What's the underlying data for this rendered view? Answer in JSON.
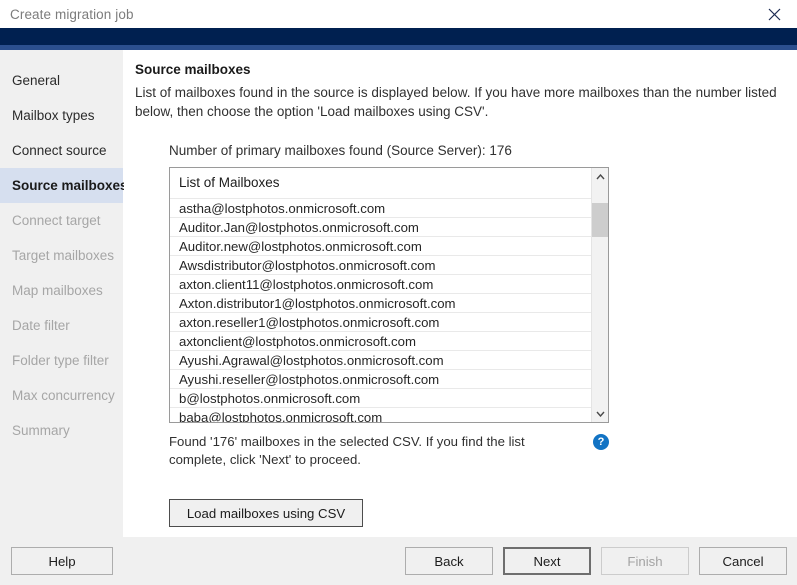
{
  "window": {
    "title": "Create migration job",
    "close_icon": "close-icon"
  },
  "sidebar": {
    "items": [
      {
        "label": "General",
        "state": "enabled"
      },
      {
        "label": "Mailbox types",
        "state": "enabled"
      },
      {
        "label": "Connect source",
        "state": "enabled"
      },
      {
        "label": "Source mailboxes",
        "state": "active"
      },
      {
        "label": "Connect target",
        "state": "disabled"
      },
      {
        "label": "Target mailboxes",
        "state": "disabled"
      },
      {
        "label": "Map mailboxes",
        "state": "disabled"
      },
      {
        "label": "Date filter",
        "state": "disabled"
      },
      {
        "label": "Folder type filter",
        "state": "disabled"
      },
      {
        "label": "Max concurrency",
        "state": "disabled"
      },
      {
        "label": "Summary",
        "state": "disabled"
      }
    ]
  },
  "main": {
    "title": "Source mailboxes",
    "description": "List of mailboxes found in the source is displayed below. If you have more mailboxes than the number listed below, then choose the option 'Load mailboxes using CSV'.",
    "count_line": "Number of primary mailboxes found (Source Server): 176",
    "list": {
      "header": "List of Mailboxes",
      "rows": [
        "astha@lostphotos.onmicrosoft.com",
        "Auditor.Jan@lostphotos.onmicrosoft.com",
        "Auditor.new@lostphotos.onmicrosoft.com",
        "Awsdistributor@lostphotos.onmicrosoft.com",
        "axton.client11@lostphotos.onmicrosoft.com",
        "Axton.distributor1@lostphotos.onmicrosoft.com",
        "axton.reseller1@lostphotos.onmicrosoft.com",
        "axtonclient@lostphotos.onmicrosoft.com",
        "Ayushi.Agrawal@lostphotos.onmicrosoft.com",
        "Ayushi.reseller@lostphotos.onmicrosoft.com",
        "b@lostphotos.onmicrosoft.com",
        "baba@lostphotos.onmicrosoft.com"
      ],
      "scroll_up_icon": "chevron-up-icon",
      "scroll_down_icon": "chevron-down-icon"
    },
    "found_text": "Found '176' mailboxes in the selected CSV. If you find the list complete, click 'Next' to proceed.",
    "help_icon_label": "?",
    "csv_button": "Load mailboxes using CSV"
  },
  "footer": {
    "help": "Help",
    "back": "Back",
    "next": "Next",
    "finish": "Finish",
    "cancel": "Cancel"
  },
  "colors": {
    "band_dark": "#002050",
    "band_light": "#2b4f8e",
    "sidebar_bg": "#f0f0f0",
    "active_nav": "#d6dfef",
    "help_blue": "#1273c4"
  }
}
